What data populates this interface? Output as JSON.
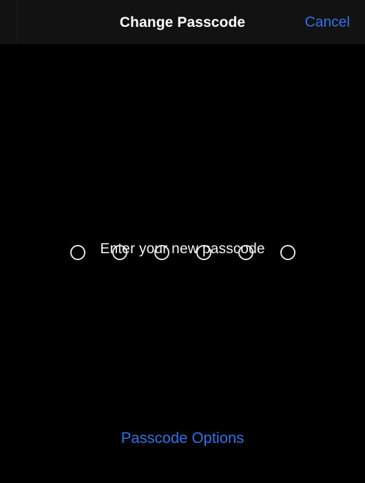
{
  "navbar": {
    "title": "Change Passcode",
    "cancel_label": "Cancel",
    "background_color": "#121212",
    "title_color": "#ffffff",
    "accent_color": "#2f73e8"
  },
  "main": {
    "background_color": "#000000",
    "prompt": "Enter your new passcode",
    "prompt_color": "#f2f2f2",
    "passcode": {
      "length": 6,
      "entered_count": 0,
      "dots": [
        {
          "filled": false
        },
        {
          "filled": false
        },
        {
          "filled": false
        },
        {
          "filled": false
        },
        {
          "filled": false
        },
        {
          "filled": false
        }
      ],
      "dot_color": "#e8e8e8"
    }
  },
  "footer": {
    "passcode_options_label": "Passcode Options",
    "passcode_options_color": "#2f73e8"
  }
}
